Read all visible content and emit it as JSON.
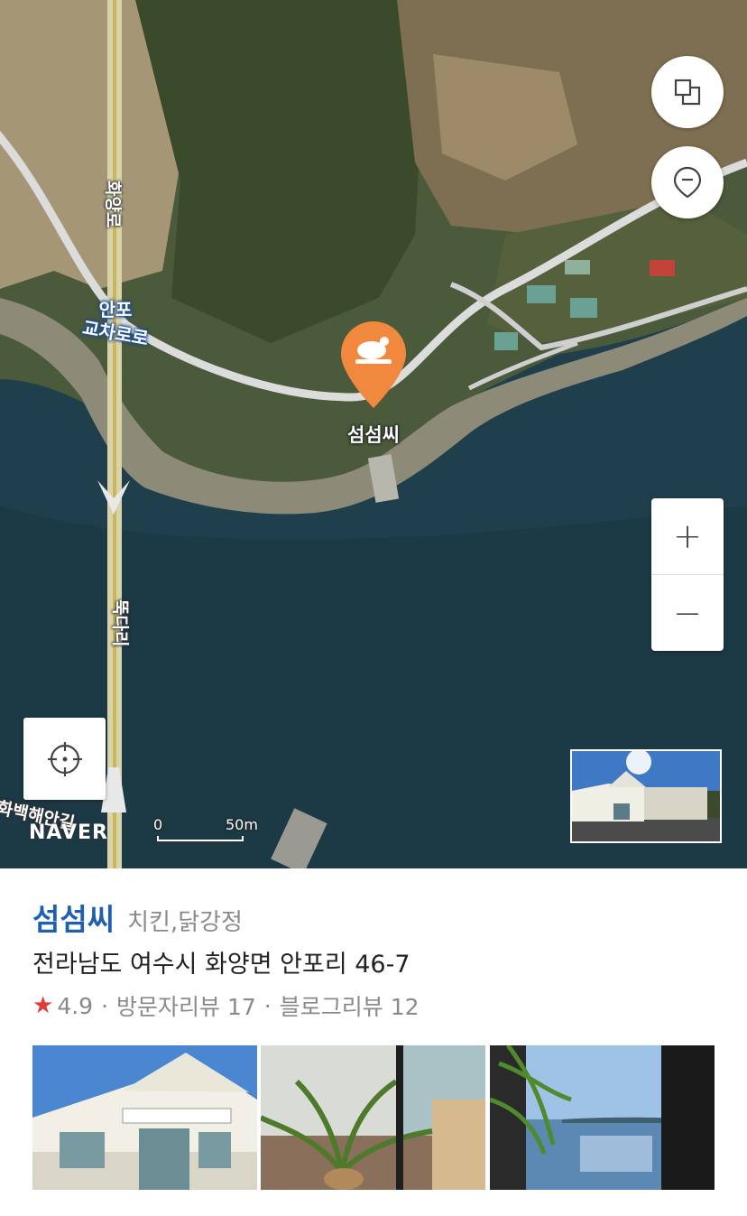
{
  "map": {
    "road_labels": {
      "hwayang_ro": "화양로",
      "ttukdari": "뚝다리",
      "hwabaek_coast": "화백해안길",
      "ro_fragment": "로"
    },
    "junction_label": {
      "line1": "안포",
      "line2": "교차로로"
    },
    "marker": {
      "name": "섬섬씨",
      "icon": "roast-chicken-icon",
      "color": "#f0883e"
    },
    "controls": {
      "layers_icon": "layers-icon",
      "pin_icon": "place-pin-icon",
      "zoom_in": "+",
      "zoom_out": "−",
      "locate_icon": "crosshair-icon"
    },
    "logo": "NAVER",
    "scale": {
      "zero": "0",
      "distance": "50m"
    }
  },
  "place": {
    "name": "섬섬씨",
    "category": "치킨,닭강정",
    "address": "전라남도 여수시 화양면 안포리 46-7",
    "rating": "4.9",
    "visitor_reviews": "방문자리뷰 17",
    "blog_reviews": "블로그리뷰 12",
    "separator": "·"
  },
  "colors": {
    "brand_blue": "#1f5fb3",
    "star_red": "#e23b3b",
    "marker_orange": "#f0883e"
  }
}
